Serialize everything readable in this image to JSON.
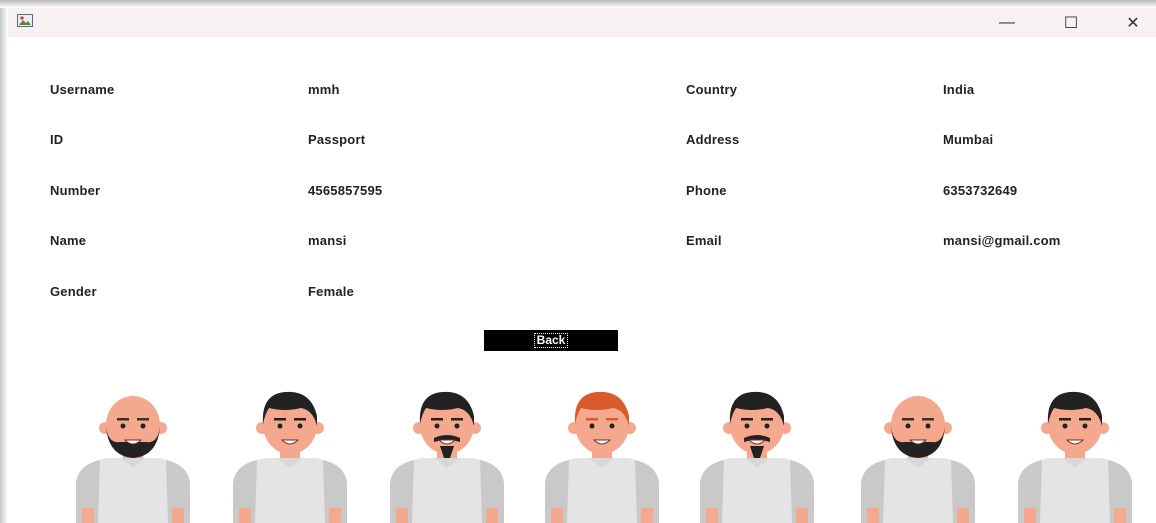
{
  "window": {
    "title": "",
    "controls": {
      "minimize": "—",
      "maximize": "☐",
      "close": "✕"
    }
  },
  "profile": {
    "left": [
      {
        "label": "Username",
        "value": "mmh"
      },
      {
        "label": "ID",
        "value": "Passport"
      },
      {
        "label": "Number",
        "value": "4565857595"
      },
      {
        "label": "Name",
        "value": "mansi"
      },
      {
        "label": "Gender",
        "value": "Female"
      }
    ],
    "right": [
      {
        "label": "Country",
        "value": "India"
      },
      {
        "label": "Address",
        "value": "Mumbai"
      },
      {
        "label": "Phone",
        "value": "6353732649"
      },
      {
        "label": "Email",
        "value": "mansi@gmail.com"
      }
    ]
  },
  "back_button": {
    "label": "Back"
  },
  "avatars": [
    {
      "hair": "bald",
      "beard": "full"
    },
    {
      "hair": "black",
      "beard": "none"
    },
    {
      "hair": "black",
      "beard": "goatee"
    },
    {
      "hair": "red",
      "beard": "none"
    },
    {
      "hair": "black",
      "beard": "goatee"
    },
    {
      "hair": "bald",
      "beard": "full"
    },
    {
      "hair": "black",
      "beard": "none"
    }
  ],
  "colors": {
    "skin": "#f4a98f",
    "hair_black": "#222222",
    "hair_red": "#d95a2b",
    "shirt": "#e4e4e4",
    "sleeve": "#c9c9c9",
    "button_bg": "#000000"
  }
}
